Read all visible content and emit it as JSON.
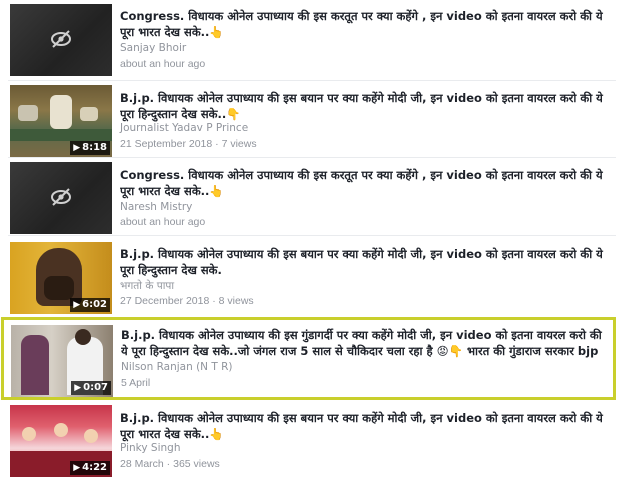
{
  "videos": [
    {
      "title": "Congress. विधायक ओनेल उपाध्याय की इस करतूत पर क्या कहेंगे , इन video को इतना वायरल करो की ये पूरा भारत देख सके..👆",
      "author": "Sanjay Bhoir",
      "meta": "about an hour ago",
      "duration": "",
      "icon": "hidden-eye-icon"
    },
    {
      "title": "B.j.p. विधायक ओनेल उपाध्याय की इस बयान पर क्या कहेंगे मोदी जी, इन video को इतना वायरल करो की ये पूरा हिन्दुस्तान देख सके..👇",
      "author": "Journalist Yadav P Prince",
      "meta": "21 September 2018 · 7 views",
      "duration": "8:18"
    },
    {
      "title": "Congress. विधायक ओनेल उपाध्याय की इस करतूत पर क्या कहेंगे , इन video को इतना वायरल करो की ये पूरा भारत देख सके..👆",
      "author": "Naresh Mistry",
      "meta": "about an hour ago",
      "duration": "",
      "icon": "hidden-eye-icon"
    },
    {
      "title": "B.j.p. विधायक ओनेल उपाध्याय की इस बयान पर क्या कहेंगे मोदी जी, इन video को इतना वायरल करो की ये पूरा हिन्दुस्तान देख सके.",
      "author": "भगतो के पापा",
      "meta": "27 December 2018 · 8 views",
      "duration": "6:02"
    },
    {
      "title": "B.j.p. विधायक ओनेल उपाध्याय की इस गुंडागर्दी पर क्या कहेंगे मोदी जी, इन video को इतना वायरल करो की ये पूरा हिन्दुस्तान देख सके..जो जंगल राज 5 साल से चौकिदार चला रहा है 😡👇 भारत की गुंडाराज सरकार bjp ...",
      "author": "Nilson Ranjan (N T R)",
      "meta": "5 April",
      "duration": "0:07"
    },
    {
      "title": "B.j.p. विधायक ओनेल उपाध्याय की इस बयान पर क्या कहेंगे मोदी जी, इन video को इतना वायरल करो की ये पूरा भारत देख सके..👆",
      "author": "Pinky Singh",
      "meta": "28 March · 365 views",
      "duration": "4:22"
    }
  ]
}
